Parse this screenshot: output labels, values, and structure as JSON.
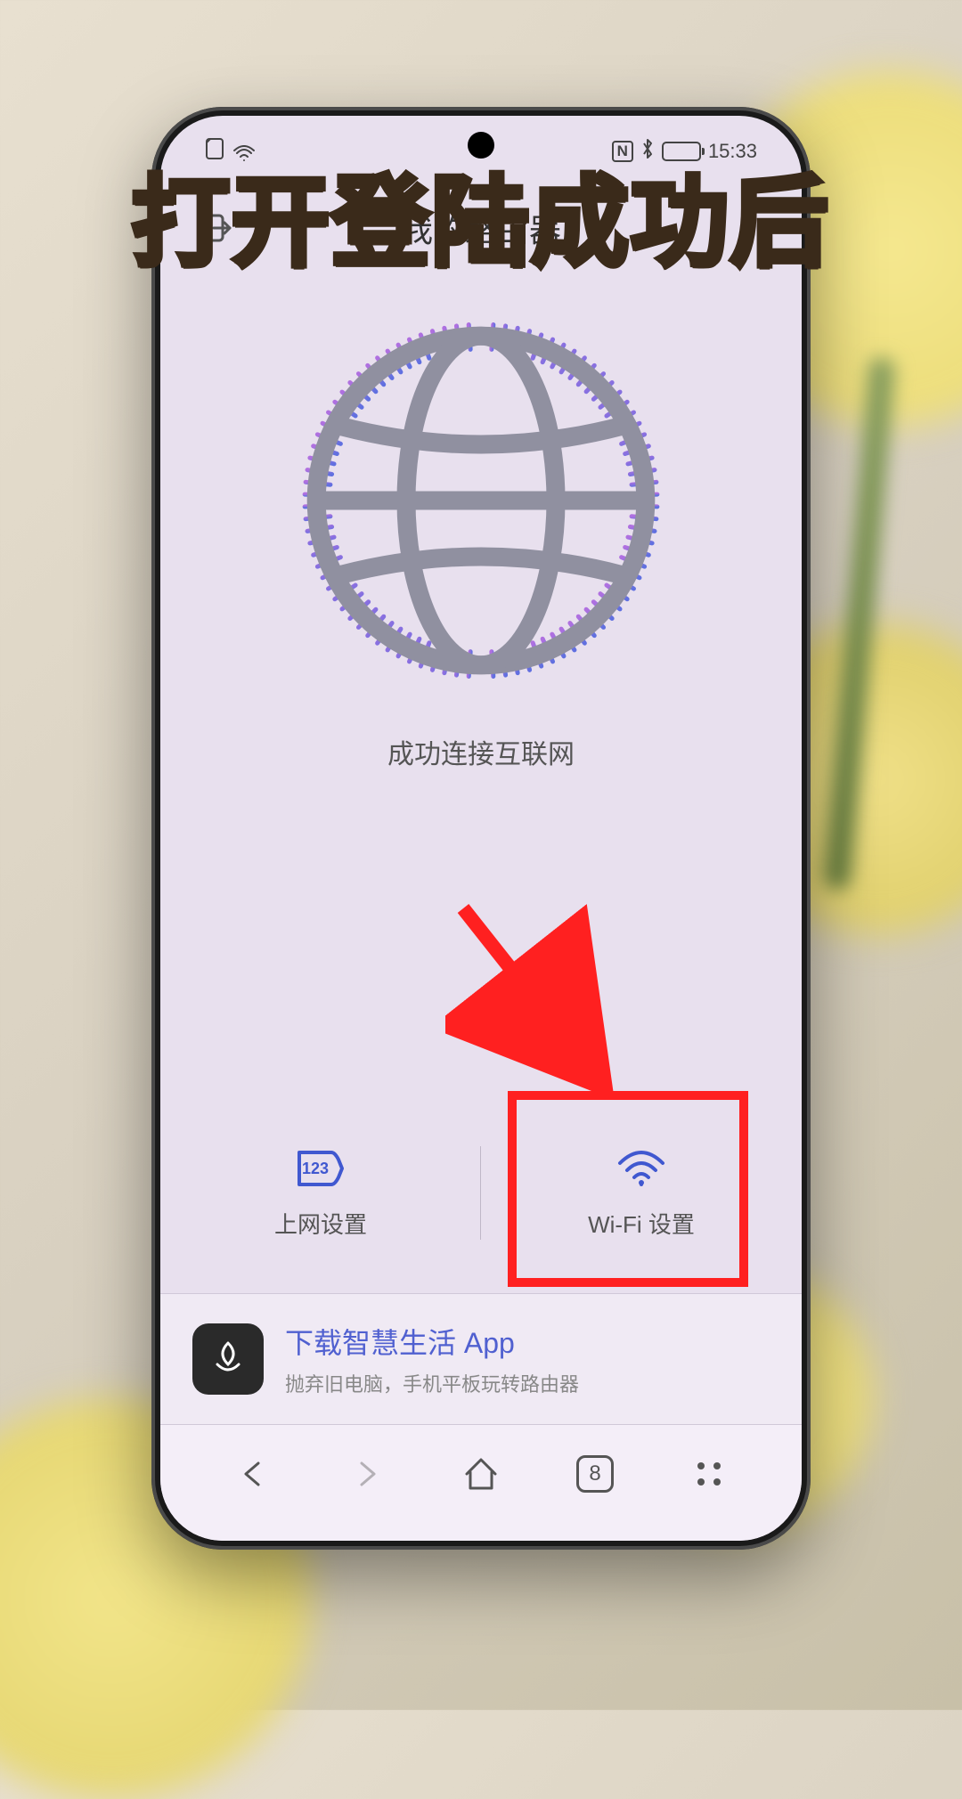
{
  "caption": "打开登陆成功后",
  "statusbar": {
    "time": "15:33",
    "nfc": "N",
    "bt": "✱"
  },
  "header": {
    "title": "我的路由器"
  },
  "main": {
    "status_text": "成功连接互联网"
  },
  "options": {
    "internet": {
      "label": "上网设置"
    },
    "wifi": {
      "label": "Wi-Fi 设置"
    }
  },
  "promo": {
    "title": "下载智慧生活 App",
    "subtitle": "抛弃旧电脑，手机平板玩转路由器"
  },
  "browser": {
    "tab_count": "8"
  }
}
